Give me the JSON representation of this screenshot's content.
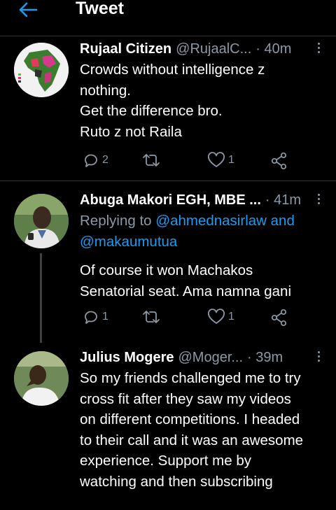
{
  "header": {
    "title": "Tweet",
    "back_icon": "arrow-left-icon",
    "accent": "#1d9bf0"
  },
  "tweets": [
    {
      "name": "Rujaal Citizen",
      "handle": "@RujaalC...",
      "time": "· 40m",
      "lines": [
        "Crowds without intelligence z",
        "nothing.",
        "Get the difference bro.",
        "Ruto z not Raila"
      ],
      "replies": "2",
      "retweets": "",
      "likes": "1"
    },
    {
      "name": "Abuga Makori EGH, MBE ...",
      "handle": "",
      "time": "· 41m",
      "replying_label": "Replying to",
      "mention1": "@ahmednasirlaw and",
      "mention2": "@makaumutua",
      "lines": [
        "Of course it won Machakos",
        "Senatorial seat. Ama namna gani"
      ],
      "replies": "1",
      "retweets": "",
      "likes": "1"
    },
    {
      "name": "Julius Mogere",
      "handle": "@Moger...",
      "time": "· 39m",
      "lines": [
        "So my friends challenged me to try",
        "cross fit after they saw my videos",
        "on different competitions. I headed",
        "to their call and it was an awesome",
        "experience. Support me by",
        "watching and then subscribing"
      ]
    }
  ],
  "colors": {
    "background": "#000000",
    "secondary_text": "#8b98a5",
    "link": "#1d9bf0",
    "divider": "#2f3336"
  }
}
